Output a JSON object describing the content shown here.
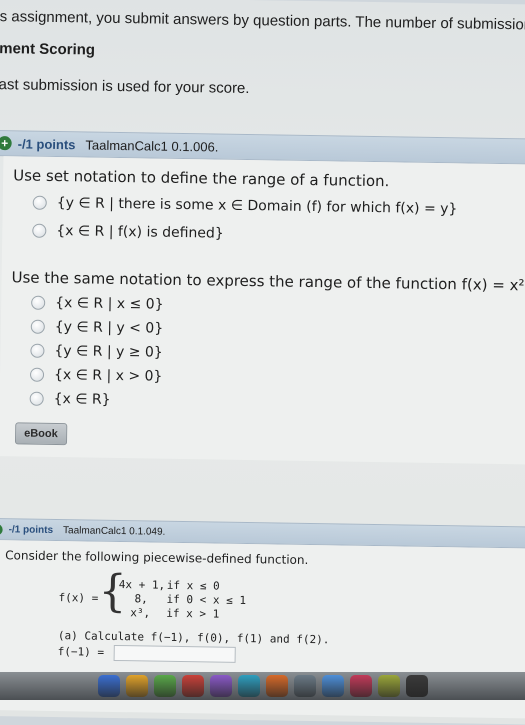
{
  "header": {
    "line1": "s assignment, you submit answers by question parts. The number of submissior",
    "line2": "ment Scoring",
    "line3": "ast submission is used for your score."
  },
  "q1": {
    "points": "-/1 points",
    "source": "TaalmanCalc1 0.1.006.",
    "prompt1": "Use set notation to define the range of a function.",
    "options1": [
      "{y ∈ R | there is some x ∈ Domain (f) for which f(x) = y}",
      "{x ∈ R | f(x) is defined}"
    ],
    "prompt2": "Use the same notation to express the range of the function f(x) = x².",
    "options2": [
      "{x ∈ R | x ≤ 0}",
      "{y ∈ R | y < 0}",
      "{y ∈ R | y ≥ 0}",
      "{x ∈ R | x > 0}",
      "{x ∈ R}"
    ],
    "ebook_label": "eBook"
  },
  "q2": {
    "points": "-/1 points",
    "source": "TaalmanCalc1 0.1.049.",
    "prompt": "Consider the following piecewise-defined function.",
    "fx_label": "f(x) =",
    "pieces": [
      {
        "expr": "4x + 1,",
        "cond": "if x ≤ 0"
      },
      {
        "expr": "8,",
        "cond": "if 0 < x ≤ 1"
      },
      {
        "expr": "x³,",
        "cond": "if x > 1"
      }
    ],
    "part_a": "(a) Calculate f(−1), f(0), f(1) and f(2).",
    "answer_label": "f(−1) ="
  },
  "dock": {
    "icon_colors": [
      "#3b6fd1",
      "#e0a22b",
      "#5aa84a",
      "#c9423a",
      "#8a5ac7",
      "#2f9fbf",
      "#d66a2a",
      "#6b7a86",
      "#4e8fd8",
      "#c23b5a",
      "#9aa63a",
      "#3a3a3a"
    ]
  }
}
